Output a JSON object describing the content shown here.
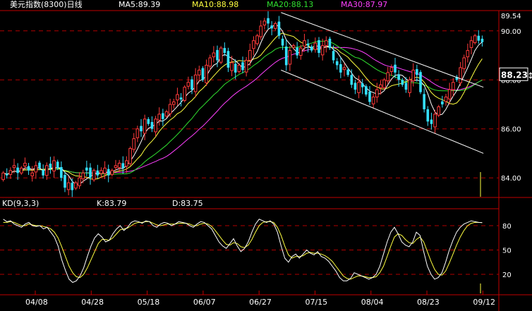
{
  "header": {
    "title": "美元指数(8300)日线",
    "ma5": "MA5:89.39",
    "ma10": "MA10:88.98",
    "ma20": "MA20:88.13",
    "ma30": "MA30:87.97"
  },
  "kd_panel": {
    "label": "KD(9,3,3)",
    "k": "K:83.79",
    "d": "D:83.75"
  },
  "colors": {
    "up": "#ff3b3b",
    "down": "#35e0ff",
    "ma5": "#ffffff",
    "ma10": "#ffff40",
    "ma20": "#30e030",
    "ma30": "#ff40ff",
    "grid": "#b00000",
    "axis_text": "#ffffff",
    "k_line": "#ffffff",
    "d_line": "#ffff40"
  },
  "chart_data": [
    {
      "type": "candlestick",
      "title": "美元指数(8300)日线",
      "y_ticks": [
        "90.00",
        "88.00",
        "86.00",
        "84.00"
      ],
      "top_value": "89.54",
      "current_value": "88.23",
      "ylim": [
        83.2,
        90.8
      ],
      "x_ticks": [
        "04/08",
        "04/28",
        "05/18",
        "06/07",
        "06/27",
        "07/15",
        "08/04",
        "08/23",
        "09/12"
      ],
      "close": [
        84.2,
        84.1,
        84.3,
        84.5,
        84.2,
        84.4,
        84.6,
        84.3,
        84.2,
        84.5,
        84.4,
        84.1,
        84.5,
        84.4,
        84.7,
        84.4,
        84.0,
        83.6,
        83.8,
        83.5,
        83.8,
        84.0,
        84.2,
        84.3,
        84.0,
        84.3,
        84.1,
        84.3,
        84.4,
        84.1,
        84.3,
        84.5,
        84.6,
        84.4,
        84.7,
        85.2,
        85.6,
        86.0,
        85.9,
        86.4,
        86.2,
        86.0,
        86.4,
        86.6,
        86.4,
        86.7,
        87.0,
        87.1,
        87.4,
        87.2,
        87.7,
        87.9,
        87.6,
        88.2,
        88.4,
        88.0,
        88.6,
        88.9,
        89.1,
        88.8,
        89.3,
        89.1,
        88.5,
        88.7,
        88.3,
        88.6,
        88.4,
        88.8,
        89.2,
        89.6,
        89.8,
        90.2,
        90.4,
        90.3,
        90.1,
        90.3,
        89.8,
        89.4,
        88.6,
        89.2,
        89.4,
        89.0,
        89.3,
        89.6,
        89.4,
        89.2,
        89.5,
        89.1,
        89.4,
        89.6,
        89.3,
        88.8,
        88.6,
        88.3,
        88.5,
        88.2,
        87.8,
        87.6,
        87.9,
        87.7,
        87.4,
        87.1,
        87.3,
        87.6,
        87.8,
        88.0,
        88.3,
        88.5,
        88.3,
        88.0,
        87.8,
        87.6,
        88.0,
        88.4,
        88.2,
        87.5,
        86.8,
        86.3,
        86.2,
        86.6,
        86.9,
        87.0,
        87.3,
        87.6,
        87.9,
        88.0,
        88.5,
        88.9,
        89.2,
        89.6,
        89.8,
        89.6,
        89.54
      ],
      "kd": {
        "ylim": [
          0,
          100
        ],
        "y_ticks": [
          "80",
          "50",
          "20"
        ],
        "k": [
          88,
          85,
          86,
          82,
          80,
          78,
          82,
          84,
          80,
          79,
          80,
          76,
          78,
          72,
          66,
          55,
          38,
          25,
          14,
          10,
          12,
          18,
          28,
          42,
          55,
          65,
          70,
          66,
          60,
          62,
          70,
          76,
          80,
          74,
          78,
          84,
          86,
          85,
          83,
          86,
          85,
          80,
          78,
          82,
          84,
          83,
          80,
          82,
          85,
          84,
          83,
          80,
          78,
          82,
          85,
          84,
          80,
          76,
          68,
          60,
          55,
          52,
          58,
          64,
          55,
          48,
          52,
          60,
          72,
          82,
          88,
          86,
          84,
          86,
          82,
          72,
          55,
          40,
          35,
          42,
          45,
          40,
          45,
          50,
          46,
          44,
          48,
          42,
          40,
          36,
          30,
          24,
          16,
          12,
          12,
          15,
          22,
          20,
          18,
          16,
          14,
          16,
          20,
          30,
          45,
          60,
          72,
          78,
          70,
          60,
          56,
          54,
          60,
          72,
          68,
          48,
          30,
          20,
          14,
          16,
          22,
          35,
          50,
          62,
          72,
          78,
          82,
          84,
          86,
          85,
          84,
          83.79
        ],
        "d": [
          84,
          84,
          85,
          84,
          82,
          80,
          80,
          82,
          81,
          80,
          80,
          79,
          78,
          76,
          72,
          65,
          54,
          42,
          30,
          22,
          17,
          16,
          20,
          28,
          38,
          48,
          58,
          63,
          63,
          62,
          65,
          70,
          75,
          76,
          77,
          80,
          83,
          84,
          84,
          85,
          85,
          83,
          81,
          80,
          81,
          82,
          82,
          82,
          83,
          83,
          83,
          82,
          80,
          80,
          82,
          83,
          82,
          79,
          74,
          68,
          62,
          57,
          56,
          59,
          58,
          54,
          53,
          56,
          63,
          72,
          80,
          84,
          85,
          85,
          84,
          78,
          68,
          55,
          44,
          40,
          42,
          42,
          43,
          46,
          47,
          46,
          46,
          45,
          43,
          40,
          36,
          30,
          24,
          18,
          15,
          14,
          16,
          18,
          18,
          17,
          16,
          16,
          17,
          22,
          30,
          42,
          55,
          66,
          70,
          68,
          63,
          59,
          58,
          63,
          66,
          60,
          48,
          36,
          26,
          20,
          19,
          24,
          34,
          45,
          56,
          66,
          74,
          80,
          83,
          84,
          84,
          83.75
        ]
      }
    }
  ]
}
